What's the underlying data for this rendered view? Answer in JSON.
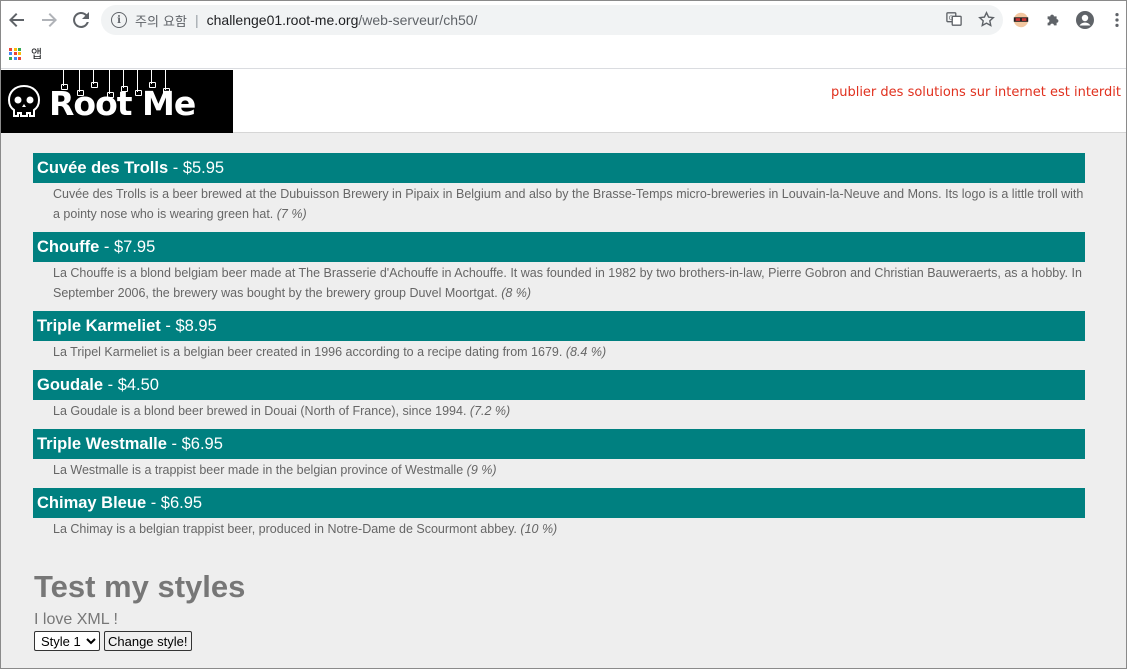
{
  "browser": {
    "security_label": "주의 요함",
    "url_host": "challenge01.root-me.org",
    "url_path": "/web-serveur/ch50/",
    "bookmarks_apps_label": "앱"
  },
  "site": {
    "logo_text": "Root Me",
    "warning": "publier des solutions sur internet est interdit"
  },
  "beers": [
    {
      "name": "Cuvée des Trolls",
      "price": "$5.95",
      "description": "Cuvée des Trolls is a beer brewed at the Dubuisson Brewery in Pipaix in Belgium and also by the Brasse-Temps micro-breweries in Louvain-la-Neuve and Mons. Its logo is a little troll with a pointy nose who is wearing green hat.",
      "strength": "(7 %)"
    },
    {
      "name": "Chouffe",
      "price": "$7.95",
      "description": "La Chouffe is a blond belgiam beer made at The Brasserie d'Achouffe in Achouffe. It was founded in 1982 by two brothers-in-law, Pierre Gobron and Christian Bauweraerts, as a hobby. In September 2006, the brewery was bought by the brewery group Duvel Moortgat.",
      "strength": "(8 %)"
    },
    {
      "name": "Triple Karmeliet",
      "price": "$8.95",
      "description": "La Tripel Karmeliet is a belgian beer created in 1996 according to a recipe dating from 1679.",
      "strength": "(8.4 %)"
    },
    {
      "name": "Goudale",
      "price": "$4.50",
      "description": "La Goudale is a blond beer brewed in Douai (North of France), since 1994.",
      "strength": "(7.2 %)"
    },
    {
      "name": "Triple Westmalle",
      "price": "$6.95",
      "description": "La Westmalle is a trappist beer made in the belgian province of Westmalle",
      "strength": "(9 %)"
    },
    {
      "name": "Chimay Bleue",
      "price": "$6.95",
      "description": "La Chimay is a belgian trappist beer, produced in Notre-Dame de Scourmont abbey.",
      "strength": "(10 %)"
    }
  ],
  "test": {
    "title": "Test my styles",
    "subtitle": "I love XML !",
    "selected_style": "Style 1",
    "button_label": "Change style!"
  },
  "colors": {
    "item_header": "#008080",
    "page_bg": "#eeeeee",
    "warning": "#e0301e"
  }
}
